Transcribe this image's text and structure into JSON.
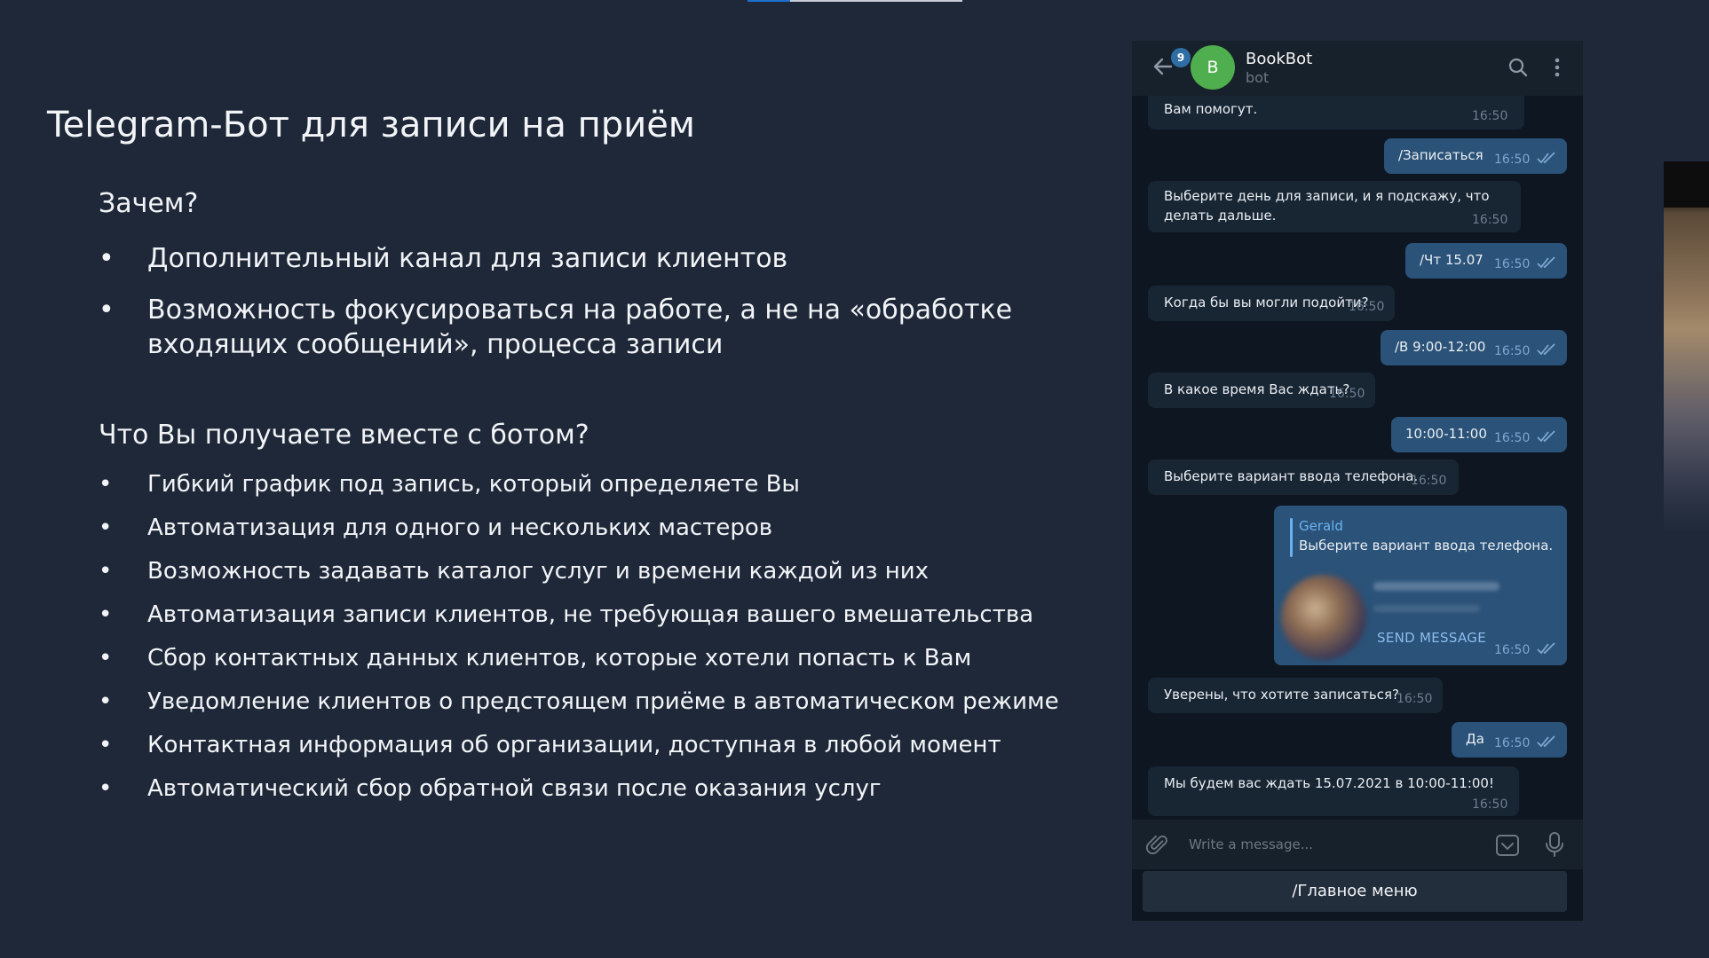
{
  "slide": {
    "title": "Telegram-Бот для записи на приём",
    "why": {
      "heading": "Зачем?",
      "items": [
        "Дополнительный канал для записи клиентов",
        "Возможность фокусироваться на работе, а не на «обработке входящих сообщений», процесса записи"
      ]
    },
    "what": {
      "heading": "Что Вы получаете вместе с ботом?",
      "items": [
        "Гибкий график под запись, который определяете Вы",
        "Автоматизация для одного и нескольких мастеров",
        "Возможность задавать каталог услуг и времени каждой из них",
        "Автоматизация записи клиентов, не требующая вашего вмешательства",
        "Сбор контактных данных клиентов, которые хотели попасть к Вам",
        "Уведомление клиентов о предстоящем приёме в автоматическом режиме",
        "Контактная информация об организации, доступная в любой момент",
        "Автоматический сбор обратной связи после оказания услуг"
      ],
      "bullet": "•"
    }
  },
  "telegram": {
    "header": {
      "unread_badge": "9",
      "avatar_letter": "B",
      "avatar_color": "#4fae4e",
      "name": "BookBot",
      "status": "bot"
    },
    "messages": [
      {
        "dir": "in",
        "text": "Вам помогут.",
        "time": "16:50"
      },
      {
        "dir": "out",
        "text": "/Записаться",
        "time": "16:50"
      },
      {
        "dir": "in",
        "text_lines": [
          "Выберите день для записи, и я подскажу, что",
          "делать дальше."
        ],
        "time": "16:50"
      },
      {
        "dir": "out",
        "text": "/Чт 15.07",
        "time": "16:50"
      },
      {
        "dir": "in",
        "text": "Когда бы вы могли подойти?",
        "time": "16:50"
      },
      {
        "dir": "out",
        "text": "/В 9:00-12:00",
        "time": "16:50"
      },
      {
        "dir": "in",
        "text": "В какое время Вас ждать?",
        "time": "16:50"
      },
      {
        "dir": "out",
        "text": "10:00-11:00",
        "time": "16:50"
      },
      {
        "dir": "in",
        "text": "Выберите вариант ввода телефона.",
        "time": "16:50"
      },
      {
        "dir": "out",
        "reply_name": "Gerald",
        "reply_text": "Выберите вариант ввода телефона.",
        "contact_action": "SEND MESSAGE",
        "time": "16:50"
      },
      {
        "dir": "in",
        "text": "Уверены, что хотите записаться?",
        "time": "16:50"
      },
      {
        "dir": "out",
        "text": "Да",
        "time": "16:50"
      },
      {
        "dir": "in",
        "text": "Мы будем вас ждать 15.07.2021 в 10:00-11:00!",
        "time": "16:50"
      }
    ],
    "input": {
      "placeholder": "Write a message..."
    },
    "keyboard": {
      "button": "/Главное меню"
    },
    "colors": {
      "incoming": "#182533",
      "outgoing": "#2b5278",
      "accent": "#6ab3f3"
    }
  }
}
